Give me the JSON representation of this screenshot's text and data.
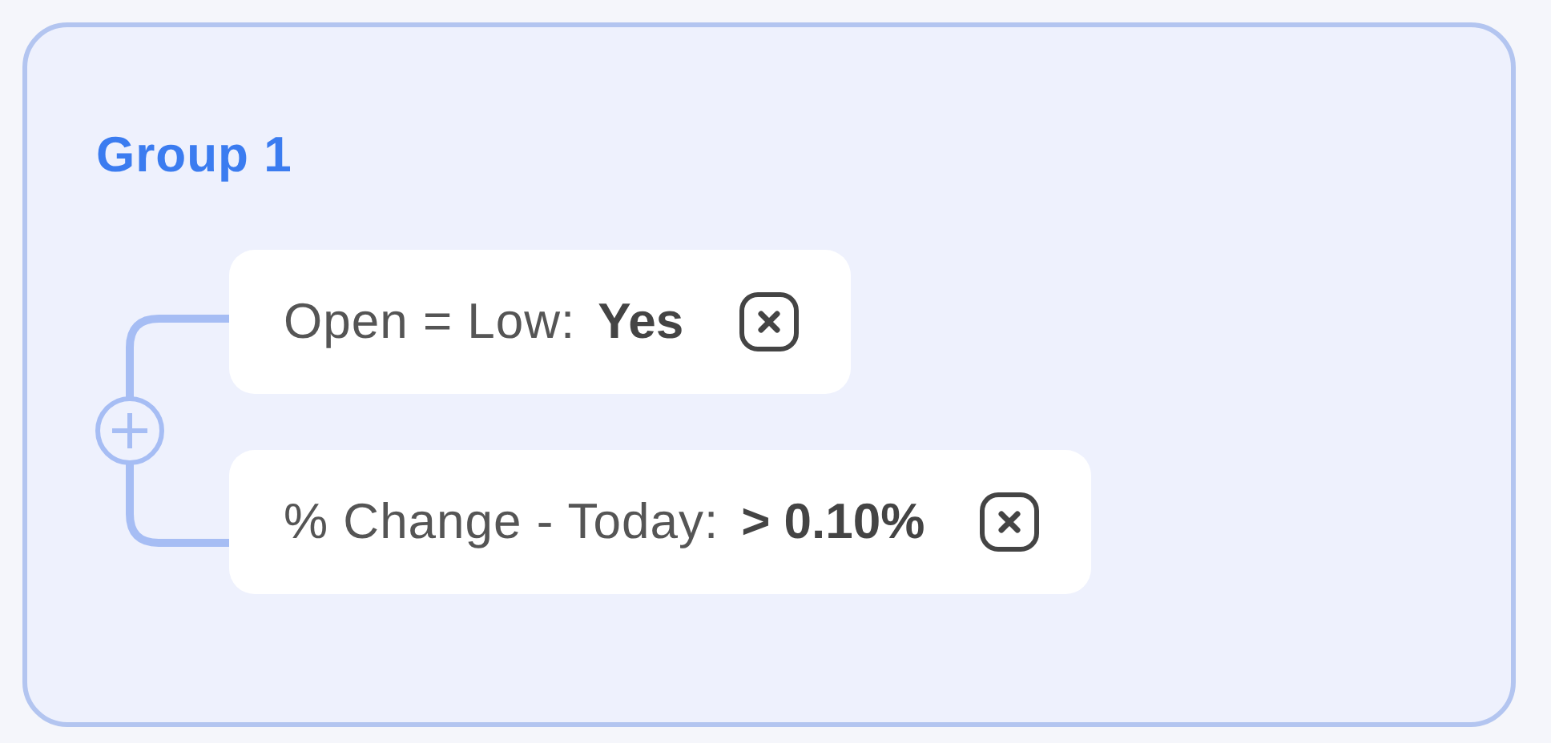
{
  "group": {
    "title": "Group 1",
    "conditions": [
      {
        "label": "Open = Low:",
        "value": "Yes"
      },
      {
        "label": "% Change - Today:",
        "value": "> 0.10%"
      }
    ]
  }
}
